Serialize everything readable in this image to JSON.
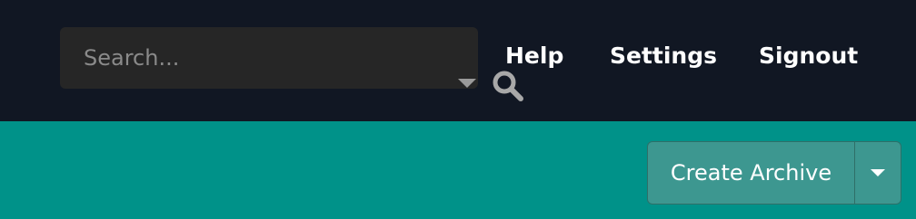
{
  "header": {
    "search": {
      "placeholder": "Search...",
      "value": "",
      "dropdown_icon": "caret-down-icon",
      "search_icon": "magnifier-icon"
    },
    "nav": [
      {
        "label": "Help"
      },
      {
        "label": "Settings"
      },
      {
        "label": "Signout"
      }
    ]
  },
  "toolbar": {
    "create_label": "Create Archive",
    "create_menu_icon": "caret-down-icon"
  },
  "colors": {
    "header_bg": "#111723",
    "search_bg": "#262626",
    "content_bg": "#009289",
    "button_bg": "#3d9790",
    "text": "#ffffff"
  }
}
